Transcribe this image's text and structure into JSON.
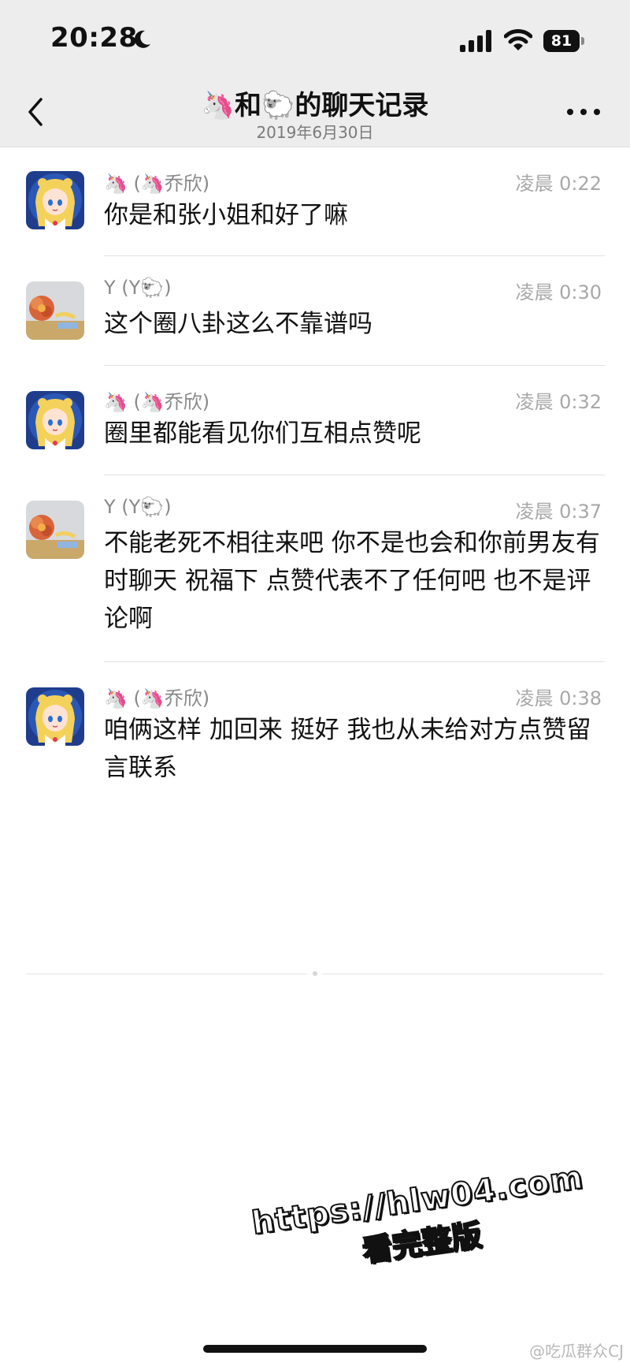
{
  "status_bar": {
    "time": "20:28",
    "battery": "81"
  },
  "nav": {
    "title": "🦄和🐑的聊天记录",
    "date": "2019年6月30日"
  },
  "messages": [
    {
      "sender": "🦄 (🦄乔欣)",
      "time": "凌晨 0:22",
      "text": "你是和张小姐和好了嘛"
    },
    {
      "sender": "Y (Y🐑)",
      "time": "凌晨 0:30",
      "text": "这个圈八卦这么不靠谱吗"
    },
    {
      "sender": "🦄 (🦄乔欣)",
      "time": "凌晨 0:32",
      "text": "圈里都能看见你们互相点赞呢"
    },
    {
      "sender": "Y (Y🐑)",
      "time": "凌晨 0:37",
      "text": "不能老死不相往来吧 你不是也会和你前男友有时聊天 祝福下 点赞代表不了任何吧 也不是评论啊"
    },
    {
      "sender": "🦄 (🦄乔欣)",
      "time": "凌晨 0:38",
      "text": "咱俩这样 加回来 挺好  我也从未给对方点赞留言联系"
    }
  ],
  "watermark": {
    "url": "https://hlw04.com",
    "sub": "看完整版"
  },
  "credit": "@吃瓜群众CJ",
  "colors": {
    "bar_bg": "#ededed",
    "text": "#111111",
    "meta": "#888888"
  },
  "icons": [
    "moon-icon",
    "signal-icon",
    "wifi-icon",
    "battery-icon",
    "back-chevron-icon",
    "more-icon"
  ]
}
